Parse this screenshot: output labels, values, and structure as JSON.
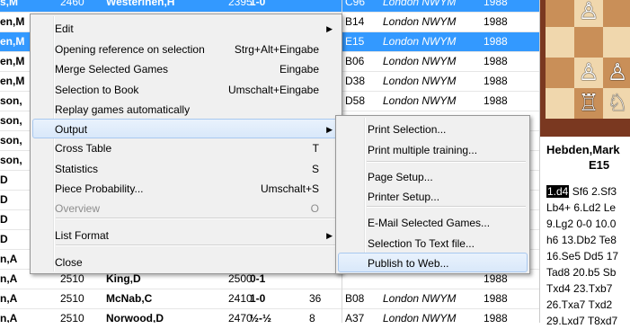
{
  "game_list": {
    "rows": [
      {
        "name": "s,M",
        "elo": "2460",
        "opponent": "Westerinen,H",
        "elo2": "2395",
        "result": "1-0",
        "moves": "",
        "eco": "C96",
        "site": "London NWYM",
        "year": "1988",
        "selected": true
      },
      {
        "name": "en,M",
        "elo": "",
        "opponent": "",
        "elo2": "",
        "result": "",
        "moves": "",
        "eco": "B14",
        "site": "London NWYM",
        "year": "1988",
        "selected": false
      },
      {
        "name": "en,M",
        "elo": "",
        "opponent": "",
        "elo2": "",
        "result": "",
        "moves": "",
        "eco": "E15",
        "site": "London NWYM",
        "year": "1988",
        "selected": true
      },
      {
        "name": "en,M",
        "elo": "",
        "opponent": "",
        "elo2": "",
        "result": "",
        "moves": "",
        "eco": "B06",
        "site": "London NWYM",
        "year": "1988",
        "selected": false
      },
      {
        "name": "en,M",
        "elo": "",
        "opponent": "",
        "elo2": "",
        "result": "",
        "moves": "",
        "eco": "D38",
        "site": "London NWYM",
        "year": "1988",
        "selected": false
      },
      {
        "name": "son,",
        "elo": "",
        "opponent": "",
        "elo2": "",
        "result": "",
        "moves": "",
        "eco": "D58",
        "site": "London NWYM",
        "year": "1988",
        "selected": false
      },
      {
        "name": "son,",
        "elo": "",
        "opponent": "",
        "elo2": "",
        "result": "",
        "moves": "",
        "eco": "",
        "site": "",
        "year": "",
        "selected": false
      },
      {
        "name": "son,",
        "elo": "",
        "opponent": "",
        "elo2": "",
        "result": "",
        "moves": "",
        "eco": "",
        "site": "",
        "year": "",
        "selected": false
      },
      {
        "name": "son,",
        "elo": "",
        "opponent": "",
        "elo2": "",
        "result": "",
        "moves": "",
        "eco": "",
        "site": "",
        "year": "",
        "selected": false
      },
      {
        "name": "D",
        "elo": "",
        "opponent": "",
        "elo2": "",
        "result": "",
        "moves": "",
        "eco": "",
        "site": "",
        "year": "",
        "selected": false
      },
      {
        "name": "D",
        "elo": "",
        "opponent": "",
        "elo2": "",
        "result": "",
        "moves": "",
        "eco": "",
        "site": "",
        "year": "",
        "selected": false
      },
      {
        "name": "D",
        "elo": "",
        "opponent": "",
        "elo2": "",
        "result": "",
        "moves": "",
        "eco": "",
        "site": "",
        "year": "",
        "selected": false
      },
      {
        "name": "D",
        "elo": "",
        "opponent": "",
        "elo2": "",
        "result": "",
        "moves": "",
        "eco": "",
        "site": "",
        "year": "",
        "selected": false
      },
      {
        "name": "n,A",
        "elo": "",
        "opponent": "",
        "elo2": "",
        "result": "",
        "moves": "",
        "eco": "",
        "site": "",
        "year": "",
        "selected": false
      },
      {
        "name": "n,A",
        "elo": "2510",
        "opponent": "King,D",
        "elo2": "2500",
        "result": "0-1",
        "moves": "",
        "eco": "",
        "site": "",
        "year": "1988",
        "selected": false
      },
      {
        "name": "n,A",
        "elo": "2510",
        "opponent": "McNab,C",
        "elo2": "2410",
        "result": "1-0",
        "moves": "36",
        "eco": "B08",
        "site": "London NWYM",
        "year": "1988",
        "selected": false
      },
      {
        "name": "n,A",
        "elo": "2510",
        "opponent": "Norwood,D",
        "elo2": "2470",
        "result": "½-½",
        "moves": "8",
        "eco": "A37",
        "site": "London NWYM",
        "year": "1988",
        "selected": false
      }
    ]
  },
  "context_menu": {
    "items": [
      {
        "label": "Edit",
        "shortcut": "",
        "submenu": true,
        "disabled": false,
        "highlight": false
      },
      {
        "label": "Opening reference on selection",
        "shortcut": "Strg+Alt+Eingabe",
        "submenu": false,
        "disabled": false,
        "highlight": false
      },
      {
        "label": "Merge Selected Games",
        "shortcut": "Eingabe",
        "submenu": false,
        "disabled": false,
        "highlight": false
      },
      {
        "label": "Selection to Book",
        "shortcut": "Umschalt+Eingabe",
        "submenu": false,
        "disabled": false,
        "highlight": false
      },
      {
        "label": "Replay games automatically",
        "shortcut": "",
        "submenu": false,
        "disabled": false,
        "highlight": false
      },
      {
        "label": "Output",
        "shortcut": "",
        "submenu": true,
        "disabled": false,
        "highlight": true
      },
      {
        "label": "Cross Table",
        "shortcut": "T",
        "submenu": false,
        "disabled": false,
        "highlight": false
      },
      {
        "label": "Statistics",
        "shortcut": "S",
        "submenu": false,
        "disabled": false,
        "highlight": false
      },
      {
        "label": "Piece Probability...",
        "shortcut": "Umschalt+S",
        "submenu": false,
        "disabled": false,
        "highlight": false
      },
      {
        "label": "Overview",
        "shortcut": "O",
        "submenu": false,
        "disabled": true,
        "highlight": false
      },
      {
        "label": "List Format",
        "shortcut": "",
        "submenu": true,
        "disabled": false,
        "highlight": false
      },
      {
        "label": "Close",
        "shortcut": "",
        "submenu": false,
        "disabled": false,
        "highlight": false
      }
    ]
  },
  "output_submenu": {
    "items": [
      {
        "label": "Print Selection...",
        "highlight": false
      },
      {
        "label": "Print multiple training...",
        "highlight": false
      },
      {
        "label": "Page Setup...",
        "highlight": false
      },
      {
        "label": "Printer Setup...",
        "highlight": false
      },
      {
        "label": "E-Mail Selected Games...",
        "highlight": false
      },
      {
        "label": "Selection To Text file...",
        "highlight": false
      },
      {
        "label": "Publish to Web...",
        "highlight": true
      }
    ]
  },
  "board_panel": {
    "header_line1": "Hebden,Mark",
    "header_line2": "E15",
    "notation": [
      [
        "1.d4",
        "Sf6",
        "2.Sf3"
      ],
      [
        "Lb4+",
        "6.Ld2",
        "Le"
      ],
      [
        "9.Lg2",
        "0-0",
        "10.0"
      ],
      [
        "h6",
        "13.Db2",
        "Te8"
      ],
      [
        "16.Se5",
        "Dd5",
        "17"
      ],
      [
        "Tad8",
        "20.b5",
        "Sb"
      ],
      [
        "Txd4",
        "23.Txb7",
        ""
      ],
      [
        "26.Txa7",
        "Txd2",
        ""
      ],
      [
        "29.Lxd7",
        "T8xd7",
        ""
      ]
    ],
    "highlight_move": "1.d4"
  }
}
